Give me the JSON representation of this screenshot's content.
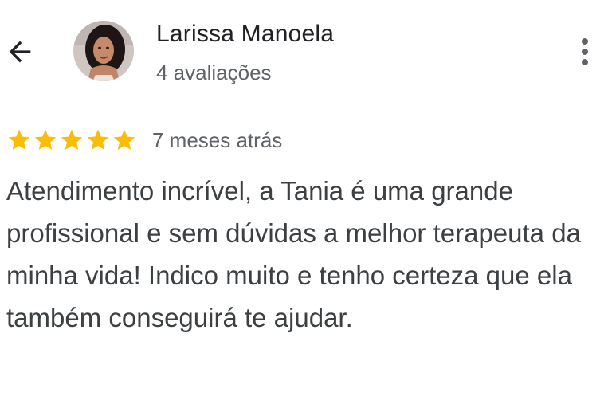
{
  "header": {
    "reviewer_name": "Larissa Manoela",
    "review_count": "4 avaliações",
    "icons": {
      "back": "arrow-back-icon",
      "more": "more-vert-icon"
    }
  },
  "review": {
    "rating": 5,
    "rating_max": 5,
    "star_color": "#fbbc04",
    "date": "7 meses atrás",
    "text": "Atendimento incrível, a Tania é uma grande profissional e sem dúvidas a melhor terapeuta da minha vida! Indico muito e tenho certeza que ela também conseguirá te ajudar."
  }
}
